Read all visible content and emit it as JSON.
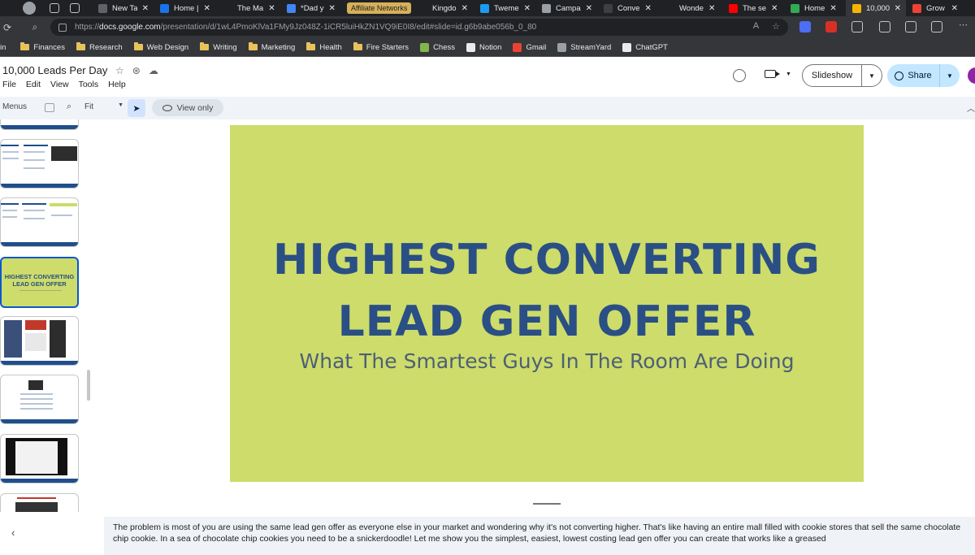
{
  "browser": {
    "tabs": [
      {
        "title": "New Ta",
        "fav": "#5f6368"
      },
      {
        "title": "Home |",
        "fav": "#1a73e8"
      },
      {
        "title": "The Ma",
        "fav": "#202124"
      },
      {
        "title": "*Dad y",
        "fav": "#4285f4"
      },
      {
        "title": "Affiliate Networks",
        "fav": "",
        "affiliate": true
      },
      {
        "title": "Kingdo",
        "fav": "#202124"
      },
      {
        "title": "Tweme",
        "fav": "#1d9bf0"
      },
      {
        "title": "Campa",
        "fav": "#9aa0a6"
      },
      {
        "title": "Conve",
        "fav": "#3c4043"
      },
      {
        "title": "Wonde",
        "fav": "#202124"
      },
      {
        "title": "The se",
        "fav": "#ff0000"
      },
      {
        "title": "Home",
        "fav": "#34a853"
      },
      {
        "title": "10,000",
        "fav": "#f4b400",
        "active": true
      },
      {
        "title": "Grow T",
        "fav": "#ea4335"
      }
    ],
    "url_prefix": "https://",
    "url_domain": "docs.google.com",
    "url_path": "/presentation/d/1wL4PmoKlVa1FMy9Jz048Z-1iCR5luiHkZN1VQ9iE0I8/edit#slide=id.g6b9abe056b_0_80",
    "bookmarks": [
      {
        "label": "in",
        "type": "none"
      },
      {
        "label": "Finances",
        "type": "folder"
      },
      {
        "label": "Research",
        "type": "folder"
      },
      {
        "label": "Web Design",
        "type": "folder"
      },
      {
        "label": "Writing",
        "type": "folder"
      },
      {
        "label": "Marketing",
        "type": "folder"
      },
      {
        "label": "Health",
        "type": "folder"
      },
      {
        "label": "Fire Starters",
        "type": "folder"
      },
      {
        "label": "Chess",
        "type": "icon",
        "color": "#81b64c"
      },
      {
        "label": "Notion",
        "type": "icon",
        "color": "#e8eaed"
      },
      {
        "label": "Gmail",
        "type": "icon",
        "color": "#ea4335"
      },
      {
        "label": "StreamYard",
        "type": "icon",
        "color": "#9aa0a6"
      },
      {
        "label": "ChatGPT",
        "type": "icon",
        "color": "#e8eaed"
      }
    ]
  },
  "doc": {
    "title": "10,000 Leads Per Day",
    "menus": [
      "File",
      "Edit",
      "View",
      "Tools",
      "Help"
    ],
    "slideshow_label": "Slideshow",
    "share_label": "Share"
  },
  "toolbar": {
    "menus_label": "Menus",
    "zoom_label": "Fit",
    "view_only_label": "View only"
  },
  "slide": {
    "title_line1": "HIGHEST CONVERTING",
    "title_line2": "LEAD GEN OFFER",
    "subtitle": "What The Smartest Guys In The Room Are Doing",
    "background": "#cddc6a",
    "title_color": "#2a4f85"
  },
  "thumbnail": {
    "title_line1": "HIGHEST CONVERTING",
    "title_line2": "LEAD GEN OFFER"
  },
  "caption": {
    "text": "The problem is most of you are using the same lead gen offer as everyone else in your market and wondering why it's not converting higher. That's like having an entire mall filled with cookie stores that sell the same chocolate chip cookie. In a sea of chocolate chip cookies you need to be a snickerdoodle! Let me show you the simplest, easiest, lowest costing lead gen offer you can create that works like a greased"
  }
}
